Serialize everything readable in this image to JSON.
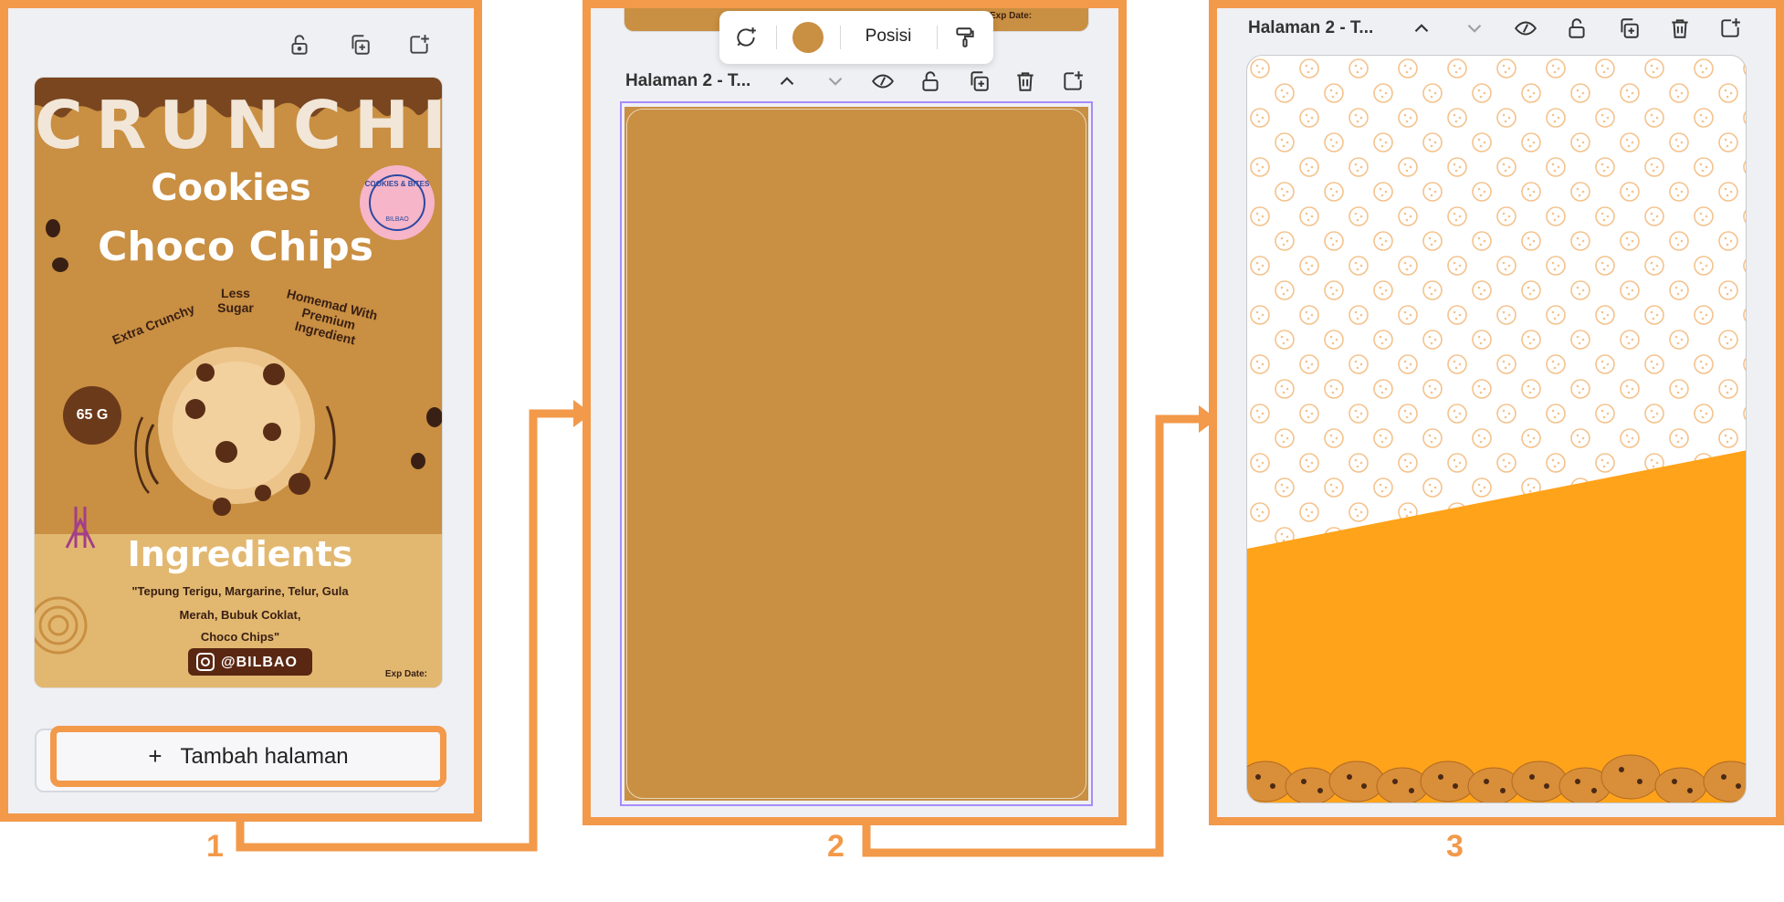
{
  "colors": {
    "accent_frame": "#f2994a",
    "panel_bg": "#eff0f4",
    "tan_page": "#c98f42",
    "orange_fill": "#ffa31a",
    "selection": "#a78bfa"
  },
  "step1": {
    "number": "1",
    "toolbar_icons": [
      "lock-icon",
      "duplicate-icon",
      "add-page-icon"
    ],
    "design": {
      "brand": "CRUNCHI",
      "title_line1": "Cookies",
      "title_line2": "Choco Chips",
      "sticker": "COOKIES & BITES",
      "sticker_sub": "BILBAO",
      "callout_1": "Extra Crunchy",
      "callout_2": "Less Sugar",
      "callout_3": "Homemad With Premium Ingredient",
      "weight": "65 G",
      "ingredients_title": "Ingredients",
      "ingredients_line1": "\"Tepung Terigu, Margarine, Telur, Gula",
      "ingredients_line2": "Merah, Bubuk Coklat,",
      "ingredients_line3": "Choco Chips\"",
      "instagram": "@BILBAO",
      "exp_date": "Exp Date:"
    },
    "add_page_button": "Tambah halaman",
    "add_page_plus": "+"
  },
  "step2": {
    "number": "2",
    "floating_toolbar": {
      "comment_icon": "comment-add-icon",
      "color_swatch": "#c98f42",
      "position_label": "Posisi",
      "paint_icon": "paint-roller-icon"
    },
    "top_peek_text": "Exp Date:",
    "page_title": "Halaman 2 - T...",
    "toolbar_icons": [
      "chevron-up-icon",
      "chevron-down-icon",
      "hide-icon",
      "lock-icon",
      "duplicate-icon",
      "delete-icon",
      "add-page-icon"
    ]
  },
  "step3": {
    "number": "3",
    "page_title": "Halaman 2 - T...",
    "toolbar_icons": [
      "chevron-up-icon",
      "chevron-down-icon",
      "hide-icon",
      "lock-icon",
      "duplicate-icon",
      "delete-icon",
      "add-page-icon"
    ]
  }
}
